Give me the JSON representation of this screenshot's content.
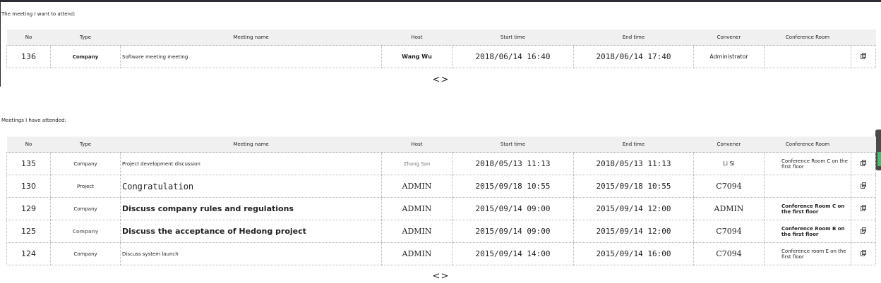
{
  "section1": {
    "title": "The meeting I want to attend:",
    "headers": [
      "No",
      "Type",
      "Meeting name",
      "Host",
      "Start time",
      "End time",
      "Convener",
      "Conference Room"
    ],
    "rows": [
      {
        "no": "136",
        "type": "Company",
        "name": "Software meeting meeting",
        "host": "Wang Wu",
        "start": "2018/06/14 16:40",
        "end": "2018/06/14 17:40",
        "convener": "Administrator",
        "room": ""
      }
    ],
    "pager": {
      "prev": "<",
      "next": ">"
    }
  },
  "section2": {
    "title": "Meetings I have attended:",
    "headers": [
      "No",
      "Type",
      "Meeting name",
      "Host",
      "Start time",
      "End time",
      "Convener",
      "Conference Room"
    ],
    "rows": [
      {
        "no": "135",
        "type": "Company",
        "name": "Project development discussion",
        "host": "Zhang San",
        "start": "2018/05/13 11:13",
        "end": "2018/05/13 11:13",
        "convener": "Li Si",
        "room": "Conference Room C on the first floor"
      },
      {
        "no": "130",
        "type": "Project",
        "name": "Congratulation",
        "host": "ADMIN",
        "start": "2015/09/18 10:55",
        "end": "2015/09/18 10:55",
        "convener": "C7094",
        "room": ""
      },
      {
        "no": "129",
        "type": "Company",
        "name": "Discuss company rules and regulations",
        "host": "ADMIN",
        "start": "2015/09/14 09:00",
        "end": "2015/09/14 12:00",
        "convener": "ADMIN",
        "room": "Conference Room C on the first floor"
      },
      {
        "no": "125",
        "type": "Company",
        "name": "Discuss the acceptance of Hedong project",
        "host": "ADMIN",
        "start": "2015/09/14 09:00",
        "end": "2015/09/14 12:00",
        "convener": "C7094",
        "room": "Conference Room B on the first floor"
      },
      {
        "no": "124",
        "type": "Company",
        "name": "Discuss system launch",
        "host": "ADMIN",
        "start": "2015/09/14 14:00",
        "end": "2015/09/14 16:00",
        "convener": "C7094",
        "room": "Conference room E on the first floor"
      }
    ],
    "pager": {
      "prev": "<",
      "next": ">"
    }
  },
  "icons": {
    "row_action": "document-copy-icon",
    "pager_prev": "chevron-left-icon",
    "pager_next": "chevron-right-icon"
  }
}
